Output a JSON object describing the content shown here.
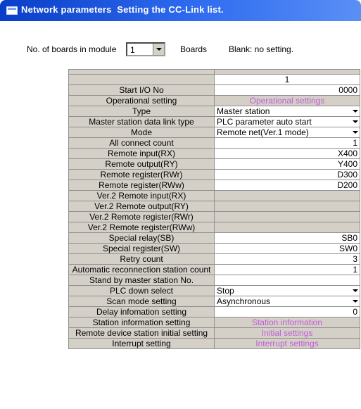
{
  "window": {
    "title": "Network parameters  Setting the CC-Link list."
  },
  "boards": {
    "label": "No. of boards in module",
    "value": "1",
    "unit": "Boards",
    "note": "Blank: no setting."
  },
  "table": {
    "column_header": "1",
    "rows": [
      {
        "label": "Start I/O No",
        "value": "0000",
        "kind": "text"
      },
      {
        "label": "Operational setting",
        "value": "Operational settings",
        "kind": "button"
      },
      {
        "label": "Type",
        "value": "Master station",
        "kind": "select"
      },
      {
        "label": "Master station data link type",
        "value": "PLC parameter auto start",
        "kind": "select"
      },
      {
        "label": "Mode",
        "value": "Remote net(Ver.1 mode)",
        "kind": "select"
      },
      {
        "label": "All connect count",
        "value": "1",
        "kind": "text"
      },
      {
        "label": "Remote input(RX)",
        "value": "X400",
        "kind": "text"
      },
      {
        "label": "Remote output(RY)",
        "value": "Y400",
        "kind": "text"
      },
      {
        "label": "Remote register(RWr)",
        "value": "D300",
        "kind": "text"
      },
      {
        "label": "Remote register(RWw)",
        "value": "D200",
        "kind": "text"
      },
      {
        "label": "Ver.2 Remote input(RX)",
        "value": "",
        "kind": "disabled"
      },
      {
        "label": "Ver.2 Remote output(RY)",
        "value": "",
        "kind": "disabled"
      },
      {
        "label": "Ver.2 Remote register(RWr)",
        "value": "",
        "kind": "disabled"
      },
      {
        "label": "Ver.2 Remote register(RWw)",
        "value": "",
        "kind": "disabled"
      },
      {
        "label": "Special relay(SB)",
        "value": "SB0",
        "kind": "text"
      },
      {
        "label": "Special register(SW)",
        "value": "SW0",
        "kind": "text"
      },
      {
        "label": "Retry count",
        "value": "3",
        "kind": "text"
      },
      {
        "label": "Automatic reconnection station count",
        "value": "1",
        "kind": "text"
      },
      {
        "label": "Stand by master station No.",
        "value": "",
        "kind": "text"
      },
      {
        "label": "PLC down select",
        "value": "Stop",
        "kind": "select"
      },
      {
        "label": "Scan mode setting",
        "value": "Asynchronous",
        "kind": "select"
      },
      {
        "label": "Delay infomation setting",
        "value": "0",
        "kind": "text"
      },
      {
        "label": "Station information setting",
        "value": "Station information",
        "kind": "button"
      },
      {
        "label": "Remote device station initial setting",
        "value": "Initial settings",
        "kind": "button"
      },
      {
        "label": "Interrupt setting",
        "value": "Interrupt settings",
        "kind": "button"
      }
    ]
  }
}
